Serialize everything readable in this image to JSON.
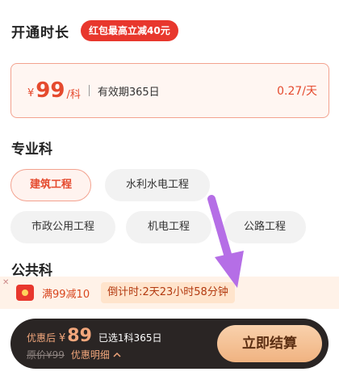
{
  "duration": {
    "title": "开通时长",
    "promo_badge": "红包最高立减40元"
  },
  "plan": {
    "currency": "¥",
    "price": "99",
    "unit": "/科",
    "validity": "有效期365日",
    "daily_price": "0.27/天"
  },
  "professional": {
    "title": "专业科",
    "options": [
      {
        "label": "建筑工程",
        "selected": true
      },
      {
        "label": "水利水电工程",
        "selected": false
      },
      {
        "label": "市政公用工程",
        "selected": false
      },
      {
        "label": "机电工程",
        "selected": false
      },
      {
        "label": "公路工程",
        "selected": false
      }
    ]
  },
  "public": {
    "title": "公共科"
  },
  "coupon": {
    "close_glyph": "✕",
    "text": "满99减10",
    "countdown": "倒计时:2天23小时58分钟"
  },
  "checkout": {
    "after_discount_label": "优惠后",
    "currency": "¥",
    "final_price": "89",
    "selected_summary": "已选1科365日",
    "original_price": "原价¥99",
    "detail_label": "优惠明细",
    "button_label": "立即结算"
  },
  "colors": {
    "accent": "#e54a2e",
    "badge_red": "#e8372d",
    "checkout_bg": "#2a2524",
    "button_gold": "#f0b381",
    "arrow_purple": "#b56ee6"
  }
}
